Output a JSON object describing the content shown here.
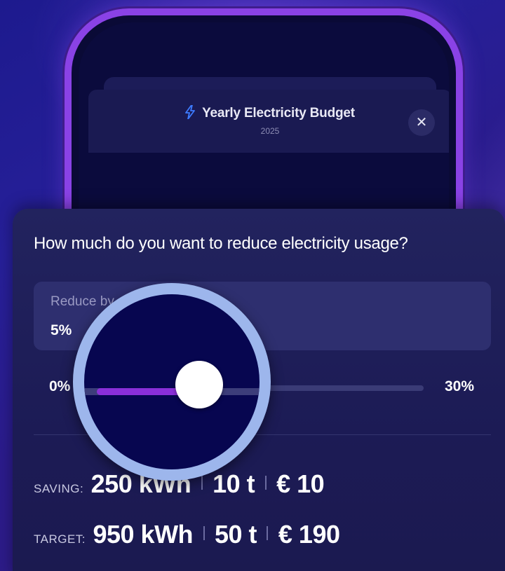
{
  "header": {
    "title": "Yearly Electricity Budget",
    "year": "2025",
    "close_label": "✕"
  },
  "sheet": {
    "question": "How much do you want to reduce electricity usage?",
    "reduce_label": "Reduce by",
    "reduce_value": "5%",
    "slider": {
      "min_label": "0%",
      "max_label": "30%",
      "value_fraction": 0.1667
    }
  },
  "saving": {
    "label": "Saving:",
    "energy": "250 kWh",
    "weight": "10 t",
    "money": "€ 10"
  },
  "target": {
    "label": "Target:",
    "energy": "950 kWh",
    "weight": "50 t",
    "money": "€ 190"
  },
  "colors": {
    "accent": "#8a2fd8",
    "phone_frame": "#8a42e6",
    "bolt": "#3d7bff",
    "magnifier_ring": "#9db6ec"
  },
  "icons": {
    "header": "lightning-bolt-icon",
    "close": "close-icon"
  }
}
